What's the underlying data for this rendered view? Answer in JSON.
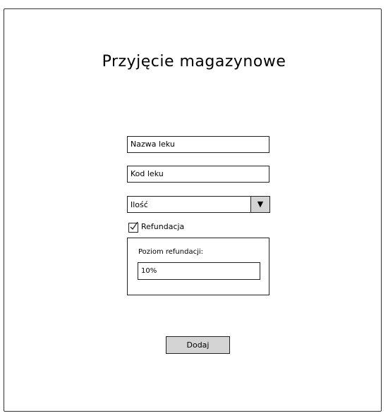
{
  "page": {
    "title": "Przyjęcie magazynowe"
  },
  "form": {
    "drug_name": {
      "placeholder": "Nazwa leku"
    },
    "drug_code": {
      "placeholder": "Kod leku"
    },
    "quantity": {
      "selected": "Ilość",
      "arrow_icon": "triangle-down-icon"
    },
    "refund_checkbox": {
      "label": "Refundacja",
      "checked": true
    },
    "refund_panel": {
      "label": "Poziom refundacji:",
      "value": "10%"
    },
    "submit_label": "Dodaj"
  }
}
